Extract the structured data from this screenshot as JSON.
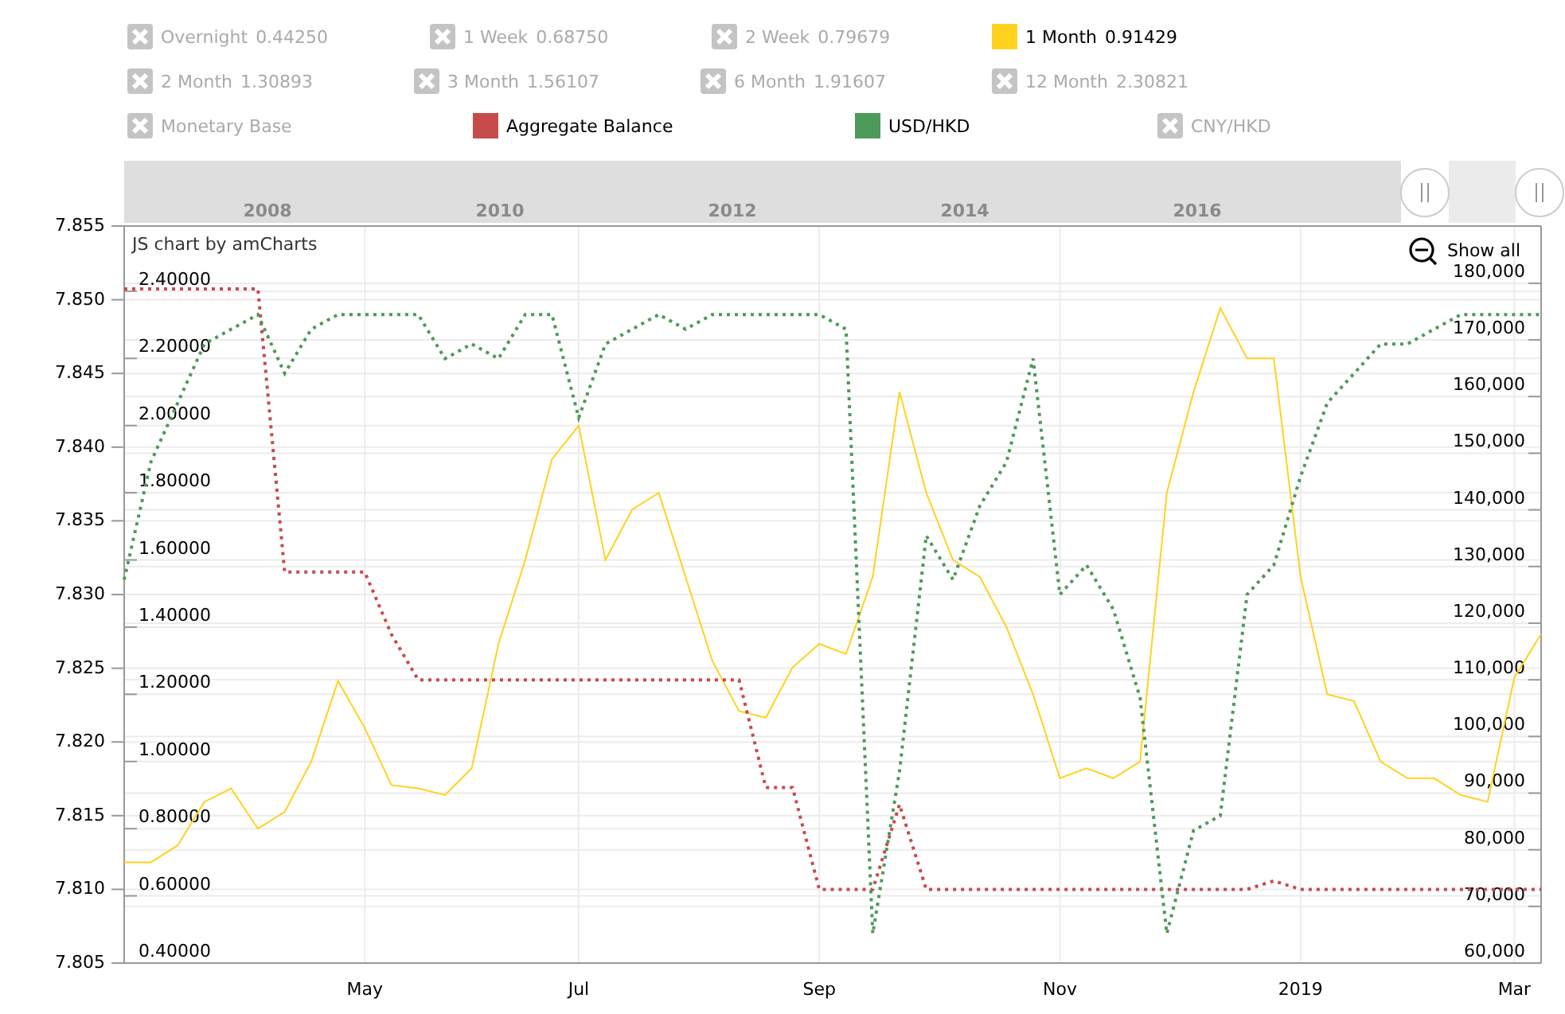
{
  "legend": {
    "rows": [
      [
        {
          "label": "Overnight",
          "value": "0.44250",
          "visible": false
        },
        {
          "label": "1 Week",
          "value": "0.68750",
          "visible": false
        },
        {
          "label": "2 Week",
          "value": "0.79679",
          "visible": false
        },
        {
          "kind": "series",
          "value": "0.91429",
          "visible": true
        }
      ],
      [
        {
          "label": "2 Month",
          "value": "1.30893",
          "visible": false
        },
        {
          "label": "3 Month",
          "value": "1.56107",
          "visible": false
        },
        {
          "label": "6 Month",
          "value": "1.91607",
          "visible": false
        },
        {
          "label": "12 Month",
          "value": "2.30821",
          "visible": false
        }
      ],
      [
        {
          "label": "Monetary Base",
          "visible": false
        },
        {
          "kind": "series",
          "visible": true
        },
        {
          "kind": "series",
          "visible": true
        },
        {
          "label": "CNY/HKD",
          "visible": false
        }
      ]
    ]
  },
  "scrollbar": {
    "year_labels": [
      "2008",
      "2010",
      "2012",
      "2014",
      "2016"
    ]
  },
  "credit": "JS chart by amCharts",
  "zoom_button": "Show all",
  "chart_data": {
    "type": "line",
    "grid": true,
    "categories": [
      null,
      null,
      null,
      null,
      null,
      null,
      null,
      null,
      null,
      "May",
      null,
      null,
      null,
      null,
      null,
      null,
      null,
      "Jul",
      null,
      null,
      null,
      null,
      null,
      null,
      null,
      null,
      "Sep",
      null,
      null,
      null,
      null,
      null,
      null,
      null,
      null,
      "Nov",
      null,
      null,
      null,
      null,
      null,
      null,
      null,
      null,
      "2019",
      null,
      null,
      null,
      null,
      null,
      null,
      null,
      "Mar",
      null
    ],
    "ylim": [
      7.805,
      7.855
    ],
    "yticks": [
      {
        "value": 7.855,
        "label": "7.855"
      },
      {
        "value": 7.85,
        "label": "7.850"
      },
      {
        "value": 7.845,
        "label": "7.845"
      },
      {
        "value": 7.84,
        "label": "7.840"
      },
      {
        "value": 7.835,
        "label": "7.835"
      },
      {
        "value": 7.83,
        "label": "7.830"
      },
      {
        "value": 7.825,
        "label": "7.825"
      },
      {
        "value": 7.82,
        "label": "7.820"
      },
      {
        "value": 7.815,
        "label": "7.815"
      },
      {
        "value": 7.81,
        "label": "7.810"
      },
      {
        "value": 7.805,
        "label": "7.805"
      }
    ],
    "y2lim": [
      0.4,
      2.594
    ],
    "y2ticks": [
      {
        "value": 2.4,
        "label": "2.40000"
      },
      {
        "value": 2.2,
        "label": "2.20000"
      },
      {
        "value": 2.0,
        "label": "2.00000"
      },
      {
        "value": 1.8,
        "label": "1.80000"
      },
      {
        "value": 1.6,
        "label": "1.60000"
      },
      {
        "value": 1.4,
        "label": "1.40000"
      },
      {
        "value": 1.2,
        "label": "1.20000"
      },
      {
        "value": 1.0,
        "label": "1.00000"
      },
      {
        "value": 0.8,
        "label": "0.80000"
      },
      {
        "value": 0.6,
        "label": "0.60000"
      },
      {
        "value": 0.4,
        "label": "0.40000"
      }
    ],
    "y3lim": [
      60000,
      190100
    ],
    "y3ticks": [
      {
        "value": 180000,
        "label": "180,000"
      },
      {
        "value": 170000,
        "label": "170,000"
      },
      {
        "value": 160000,
        "label": "160,000"
      },
      {
        "value": 150000,
        "label": "150,000"
      },
      {
        "value": 140000,
        "label": "140,000"
      },
      {
        "value": 130000,
        "label": "130,000"
      },
      {
        "value": 120000,
        "label": "120,000"
      },
      {
        "value": 110000,
        "label": "110,000"
      },
      {
        "value": 100000,
        "label": "100,000"
      },
      {
        "value": 90000,
        "label": "90,000"
      },
      {
        "value": 80000,
        "label": "80,000"
      },
      {
        "value": 70000,
        "label": "70,000"
      },
      {
        "value": 60000,
        "label": "60,000"
      }
    ],
    "series": [
      {
        "name": "1 Month",
        "color": "#ffd21f",
        "axis": "y2",
        "line_style": "solid",
        "values": [
          0.7,
          0.7,
          0.75,
          0.88,
          0.92,
          0.8,
          0.85,
          1.0,
          1.24,
          1.1,
          0.93,
          0.92,
          0.9,
          0.98,
          1.35,
          1.6,
          1.9,
          2.0,
          1.6,
          1.75,
          1.8,
          1.55,
          1.3,
          1.15,
          1.13,
          1.28,
          1.35,
          1.32,
          1.55,
          2.1,
          1.8,
          1.6,
          1.55,
          1.4,
          1.2,
          0.95,
          0.98,
          0.95,
          1.0,
          1.8,
          2.1,
          2.35,
          2.2,
          2.2,
          1.55,
          1.2,
          1.18,
          1.0,
          0.95,
          0.95,
          0.9,
          0.88,
          1.25,
          1.38
        ]
      },
      {
        "name": "Aggregate Balance",
        "color": "#c84b4b",
        "axis": "y3",
        "line_style": "dotted",
        "values": [
          179000,
          179000,
          179000,
          179000,
          179000,
          179000,
          129000,
          129000,
          129000,
          129000,
          118000,
          110000,
          110000,
          110000,
          110000,
          110000,
          110000,
          110000,
          110000,
          110000,
          110000,
          110000,
          110000,
          110000,
          91000,
          91000,
          73000,
          73000,
          73000,
          88000,
          73000,
          73000,
          73000,
          73000,
          73000,
          73000,
          73000,
          73000,
          73000,
          73000,
          73000,
          73000,
          73000,
          74500,
          73000,
          73000,
          73000,
          73000,
          73000,
          73000,
          73000,
          73000,
          73000,
          73000
        ]
      },
      {
        "name": "USD/HKD",
        "color": "#4e9a5a",
        "line_style": "dotted",
        "values": [
          7.831,
          7.839,
          7.843,
          7.847,
          7.848,
          7.849,
          7.845,
          7.848,
          7.849,
          7.849,
          7.849,
          7.849,
          7.846,
          7.847,
          7.846,
          7.849,
          7.849,
          7.842,
          7.847,
          7.848,
          7.849,
          7.848,
          7.849,
          7.849,
          7.849,
          7.849,
          7.849,
          7.848,
          7.807,
          7.818,
          7.834,
          7.831,
          7.836,
          7.839,
          7.846,
          7.83,
          7.832,
          7.829,
          7.823,
          7.807,
          7.814,
          7.815,
          7.83,
          7.832,
          7.838,
          7.843,
          7.845,
          7.847,
          7.847,
          7.848,
          7.849,
          7.849,
          7.849,
          7.849
        ]
      }
    ]
  }
}
